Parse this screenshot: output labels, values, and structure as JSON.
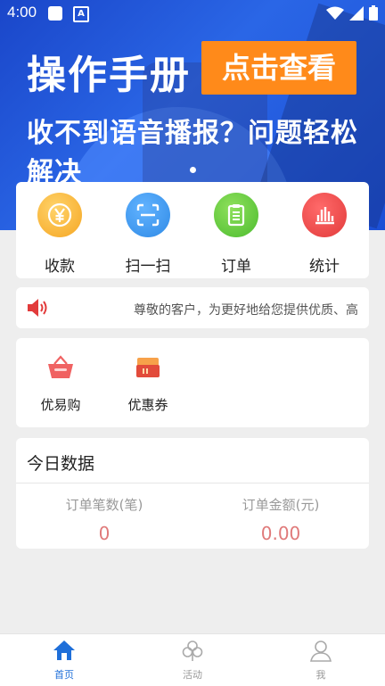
{
  "status": {
    "time": "4:00"
  },
  "banner": {
    "title": "操作手册",
    "button": "点击查看",
    "subtitle": "收不到语音播报？问题轻松解决"
  },
  "quick_actions": [
    {
      "label": "收款",
      "icon": "cny-coin-icon",
      "color": "#f5a623"
    },
    {
      "label": "扫一扫",
      "icon": "scan-icon",
      "color": "#2f8ae6"
    },
    {
      "label": "订单",
      "icon": "clipboard-icon",
      "color": "#4cbc2f"
    },
    {
      "label": "统计",
      "icon": "bar-stats-icon",
      "color": "#e23b3b"
    }
  ],
  "notice": {
    "text": "尊敬的客户，为更好地给您提供优质、高"
  },
  "services": [
    {
      "label": "优易购",
      "icon": "shopping-basket-icon"
    },
    {
      "label": "优惠券",
      "icon": "coupon-icon"
    }
  ],
  "today": {
    "title": "今日数据",
    "order_count_label": "订单笔数(笔)",
    "order_count_value": "0",
    "order_amount_label": "订单金额(元)",
    "order_amount_value": "0.00"
  },
  "tabs": [
    {
      "label": "首页",
      "active": true
    },
    {
      "label": "活动",
      "active": false
    },
    {
      "label": "我",
      "active": false
    }
  ],
  "colors": {
    "accent": "#1f6fd9",
    "banner_button": "#ff8a1a",
    "value": "#e07a7a"
  }
}
